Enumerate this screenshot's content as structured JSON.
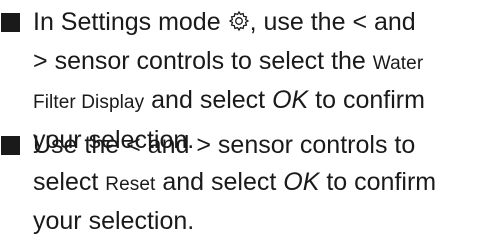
{
  "instructions": [
    {
      "line1_a": "In Settings mode",
      "settings_icon": "gear-icon",
      "line1_b": ", use the",
      "left_symbol": "<",
      "and_1": "and",
      "right_symbol": ">",
      "line2_a": "sensor controls to select the",
      "ui_water_filter_display_a": "Water",
      "ui_water_filter_display_b": "Filter Display",
      "and_select": "and select",
      "ok": "OK",
      "to_confirm": "to confirm",
      "your_selection": "your selection."
    },
    {
      "use_the": "Use the",
      "left_symbol": "<",
      "and": "and",
      "right_symbol": ">",
      "sensor_controls_to": "sensor controls to",
      "select": "select",
      "ui_reset": "Reset",
      "and_select": "and select",
      "ok": "OK",
      "to_confirm": "to confirm",
      "your_selection": "your selection."
    }
  ],
  "colors": {
    "text": "#1a1a1a",
    "background": "#ffffff"
  }
}
